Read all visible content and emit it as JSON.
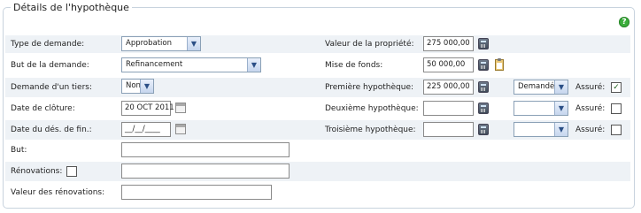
{
  "section": {
    "title": "Détails de l'hypothèque",
    "help_icon": "question-icon",
    "help_color": "#3cae3c"
  },
  "left": {
    "type_demande": {
      "label": "Type de demande:",
      "value": "Approbation"
    },
    "but_demande": {
      "label": "But de la demande:",
      "value": "Refinancement"
    },
    "demande_tiers": {
      "label": "Demande d'un tiers:",
      "value": "Non"
    },
    "date_cloture": {
      "label": "Date de clôture:",
      "value": "20 OCT 2011"
    },
    "date_des_fin": {
      "label": "Date du dés. de fin.:",
      "value": "__/__/____"
    },
    "but": {
      "label": "But:",
      "value": ""
    },
    "renovations": {
      "label": "Rénovations:",
      "checked": false,
      "value": ""
    },
    "valeur_renovations": {
      "label": "Valeur des rénovations:",
      "value": ""
    }
  },
  "right": {
    "valeur_propriete": {
      "label": "Valeur de la propriété:",
      "value": "275 000,00"
    },
    "mise_de_fonds": {
      "label": "Mise de fonds:",
      "value": "50 000,00"
    },
    "premiere": {
      "label": "Première hypothèque:",
      "value": "225 000,00",
      "status": "Demandé",
      "assure_label": "Assuré:",
      "assure": true
    },
    "deuxieme": {
      "label": "Deuxième hypothèque:",
      "value": "",
      "status": "",
      "assure_label": "Assuré:",
      "assure": false
    },
    "troisieme": {
      "label": "Troisième hypothèque:",
      "value": "",
      "status": "",
      "assure_label": "Assuré:",
      "assure": false
    }
  },
  "colors": {
    "row_alt": "#eef2f6",
    "border": "#c8d3de"
  }
}
